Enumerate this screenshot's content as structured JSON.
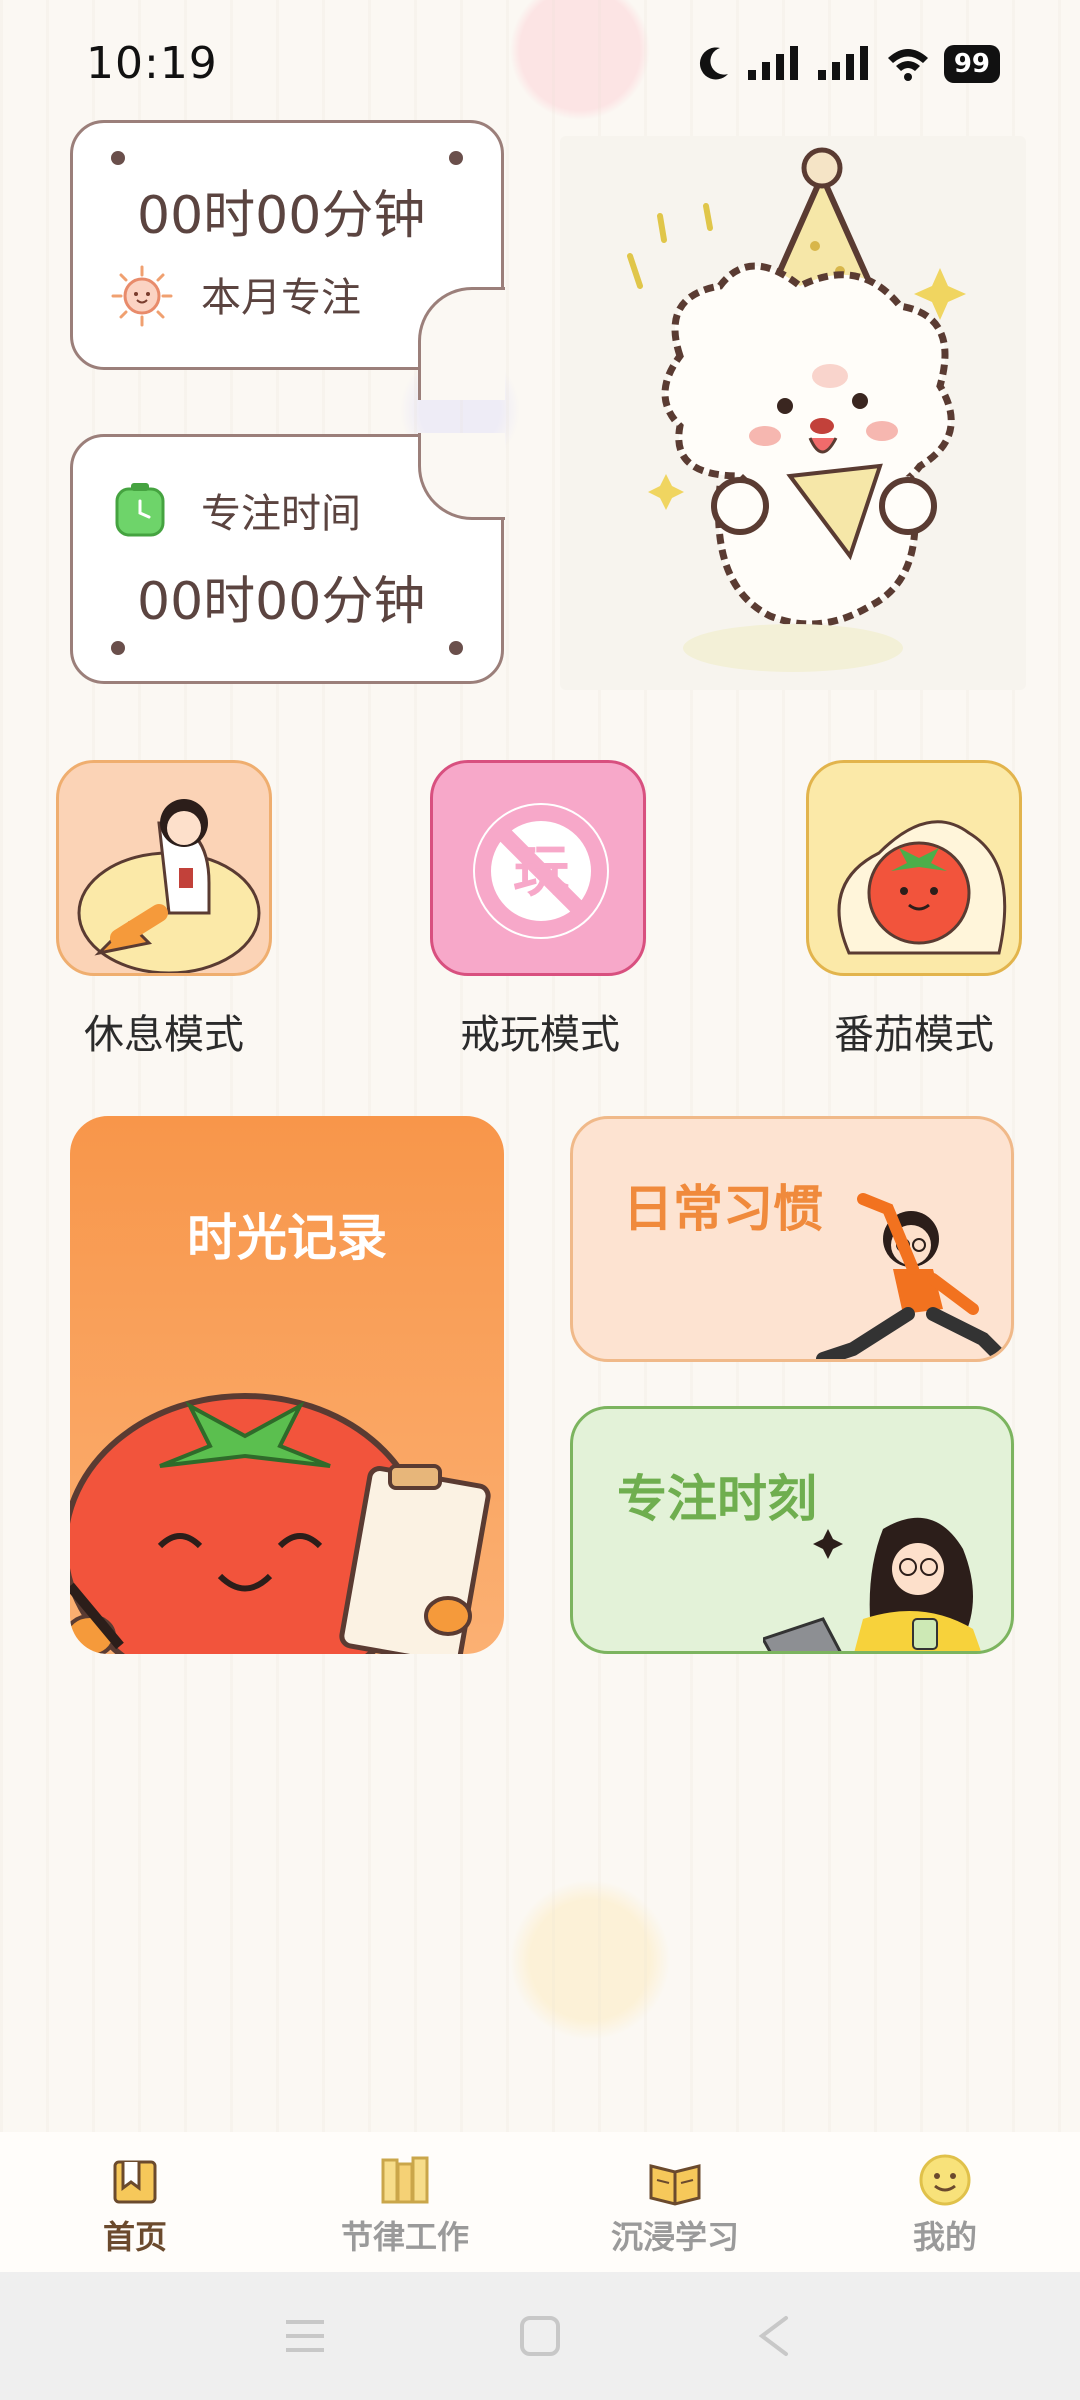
{
  "status_bar": {
    "time": "10:19",
    "battery": "99"
  },
  "stats": {
    "month": {
      "value": "00时00分钟",
      "label": "本月专注"
    },
    "focus": {
      "label": "专注时间",
      "value": "00时00分钟"
    }
  },
  "modes": [
    {
      "label": "休息模式",
      "icon": "girl-on-beanbag-icon"
    },
    {
      "label": "戒玩模式",
      "icon": "no-play-icon",
      "glyph": "玩"
    },
    {
      "label": "番茄模式",
      "icon": "tomato-on-beanbag-icon"
    }
  ],
  "features": {
    "time_record": "时光记录",
    "daily_habit": "日常习惯",
    "focus_moment": "专注时刻"
  },
  "bottom_nav": [
    {
      "label": "首页",
      "icon": "bookmark-home-icon",
      "active": true
    },
    {
      "label": "节律工作",
      "icon": "books-icon",
      "active": false
    },
    {
      "label": "沉浸学习",
      "icon": "open-book-icon",
      "active": false
    },
    {
      "label": "我的",
      "icon": "smiley-face-icon",
      "active": false
    }
  ],
  "colors": {
    "accent_brown": "#6b4a2d",
    "orange": "#f08a3c",
    "green": "#6fae4f",
    "pink": "#f7a8c9"
  }
}
